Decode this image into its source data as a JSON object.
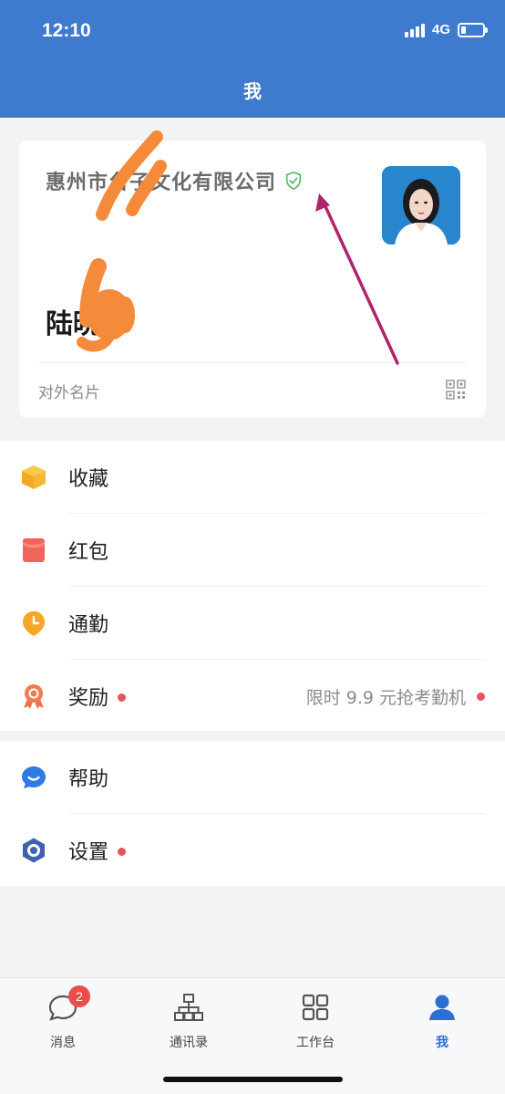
{
  "status_bar": {
    "time": "12:10",
    "network": "4G"
  },
  "header": {
    "title": "我"
  },
  "card": {
    "company": "惠州市台子文化有限公司",
    "name": "陆晓",
    "footer_label": "对外名片"
  },
  "menu": {
    "favorites": "收藏",
    "red_packet": "红包",
    "commute": "通勤",
    "rewards": "奖励",
    "rewards_promo": "限时 9.9 元抢考勤机",
    "help": "帮助",
    "settings": "设置"
  },
  "tabbar": {
    "messages": "消息",
    "messages_badge": "2",
    "contacts": "通讯录",
    "workbench": "工作台",
    "me": "我"
  },
  "colors": {
    "header_blue": "#3e7ace",
    "accent_blue": "#2c6fd1",
    "red_dot": "#e8545a"
  }
}
